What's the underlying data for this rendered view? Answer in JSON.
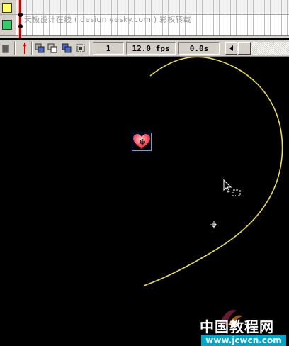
{
  "timeline": {
    "watermark_text": "天极设计在线 ( design.yesky.com ) 彩权转载",
    "layers": [
      {
        "color": "#ffff66"
      },
      {
        "color": "#33cc66"
      }
    ],
    "current_frame": "1",
    "frame_rate": "12.0 fps",
    "elapsed_time": "0.0s"
  },
  "icons": {
    "trash": "trash-icon",
    "onion_center": "center-frame-icon",
    "onion_skin": "onion-skin-icon",
    "onion_outlines": "onion-outlines-icon",
    "edit_multiple": "edit-multiple-frames-icon",
    "onion_markers": "onion-markers-icon"
  },
  "stage": {
    "background": "#000000",
    "path_color": "#e6dc4b",
    "heart_color": "#ff5a6a"
  },
  "watermark": {
    "main": "中国教程网",
    "url": "www.jcwcn.com"
  }
}
